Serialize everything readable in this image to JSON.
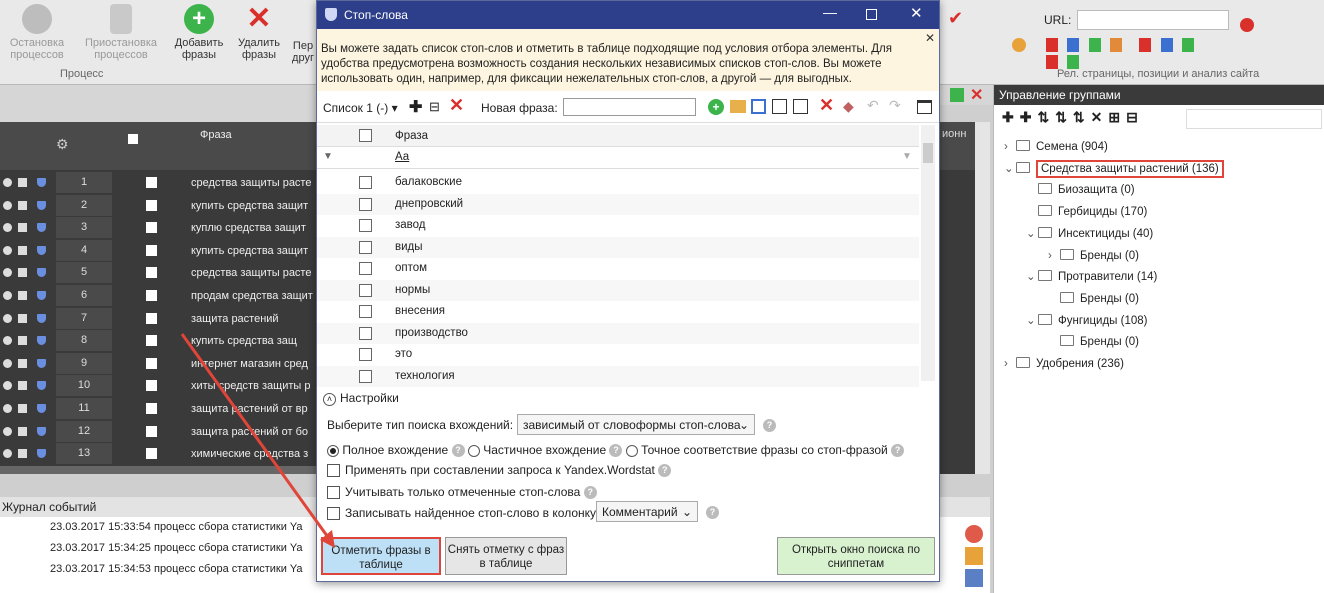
{
  "ribbon": {
    "buttons": [
      {
        "label": "Остановка процессов"
      },
      {
        "label": "Приостановка процессов"
      },
      {
        "label": "Добавить фразы"
      },
      {
        "label": "Удалить фразы"
      },
      {
        "label": "Пер друг"
      }
    ],
    "group_label": "Процесс",
    "url_label": "URL:",
    "right_group_label": "Рел. страницы, позиции и анализ сайта"
  },
  "table": {
    "phrase_header": "Фраза",
    "rows": [
      {
        "n": "1",
        "phrase": "средства защиты расте"
      },
      {
        "n": "2",
        "phrase": "купить средства защит"
      },
      {
        "n": "3",
        "phrase": "куплю средства защит"
      },
      {
        "n": "4",
        "phrase": "купить средства защит"
      },
      {
        "n": "5",
        "phrase": "средства защиты расте"
      },
      {
        "n": "6",
        "phrase": "продам средства защит"
      },
      {
        "n": "7",
        "phrase": "защита растений"
      },
      {
        "n": "8",
        "phrase": "купить средства защ"
      },
      {
        "n": "9",
        "phrase": "интернет магазин сред"
      },
      {
        "n": "10",
        "phrase": "хиты средств защиты р"
      },
      {
        "n": "11",
        "phrase": "защита растений от вр"
      },
      {
        "n": "12",
        "phrase": "защита растений от бо"
      },
      {
        "n": "13",
        "phrase": "химические средства з"
      }
    ]
  },
  "log": {
    "title": "Журнал событий",
    "rows": [
      {
        "text": "23.03.2017 15:33:54  процесс сбора статистики Ya"
      },
      {
        "text": "23.03.2017 15:34:25  процесс сбора статистики Ya"
      },
      {
        "text": "23.03.2017 15:34:53  процесс сбора статистики Ya"
      }
    ]
  },
  "dialog": {
    "title": "Стоп-слова",
    "info_text": "Вы можете задать список стоп-слов и отметить в таблице подходящие под условия отбора элементы. Для удобства предусмотрена возможность создания нескольких независимых списков стоп-слов. Вы можете использовать один, например, для фиксации нежелательных стоп-слов, а другой — для выгодных.",
    "list_label": "Список 1 (-)",
    "new_phrase_label": "Новая фраза:",
    "grid_header": "Фраза",
    "filter_text": "Аа",
    "words": [
      "балаковские",
      "днепровский",
      "завод",
      "виды",
      "оптом",
      "нормы",
      "внесения",
      "производство",
      "это",
      "технология"
    ],
    "settings_label": "Настройки",
    "search_type_label": "Выберите тип поиска вхождений:",
    "search_type_value": "зависимый от словоформы стоп-слова",
    "radio_full": "Полное вхождение",
    "radio_partial": "Частичное вхождение",
    "radio_exact": "Точное соответствие фразы со стоп-фразой",
    "check_wordstat": "Применять при составлении запроса к Yandex.Wordstat",
    "check_marked": "Учитывать только отмеченные стоп-слова",
    "check_write": "Записывать найденное стоп-слово в колонку",
    "column_value": "Комментарий",
    "btn_mark": "Отметить фразы в таблице",
    "btn_unmark": "Снять отметку с фраз в таблице",
    "btn_snippets": "Открыть окно поиска по сниппетам"
  },
  "groups": {
    "title": "Управление группами",
    "nodes": [
      {
        "label": "Семена (904)"
      },
      {
        "label": "Средства защиты растений (136)"
      },
      {
        "label": "Биозащита (0)"
      },
      {
        "label": "Гербициды (170)"
      },
      {
        "label": "Инсектициды (40)"
      },
      {
        "label": "Бренды (0)"
      },
      {
        "label": "Протравители (14)"
      },
      {
        "label": "Бренды (0)"
      },
      {
        "label": "Фунгициды (108)"
      },
      {
        "label": "Бренды (0)"
      },
      {
        "label": "Удобрения (236)"
      }
    ]
  },
  "colors": {
    "highlight": "#e0453a",
    "titlebar": "#2d3f8a",
    "info_bg": "#fdf5df"
  }
}
